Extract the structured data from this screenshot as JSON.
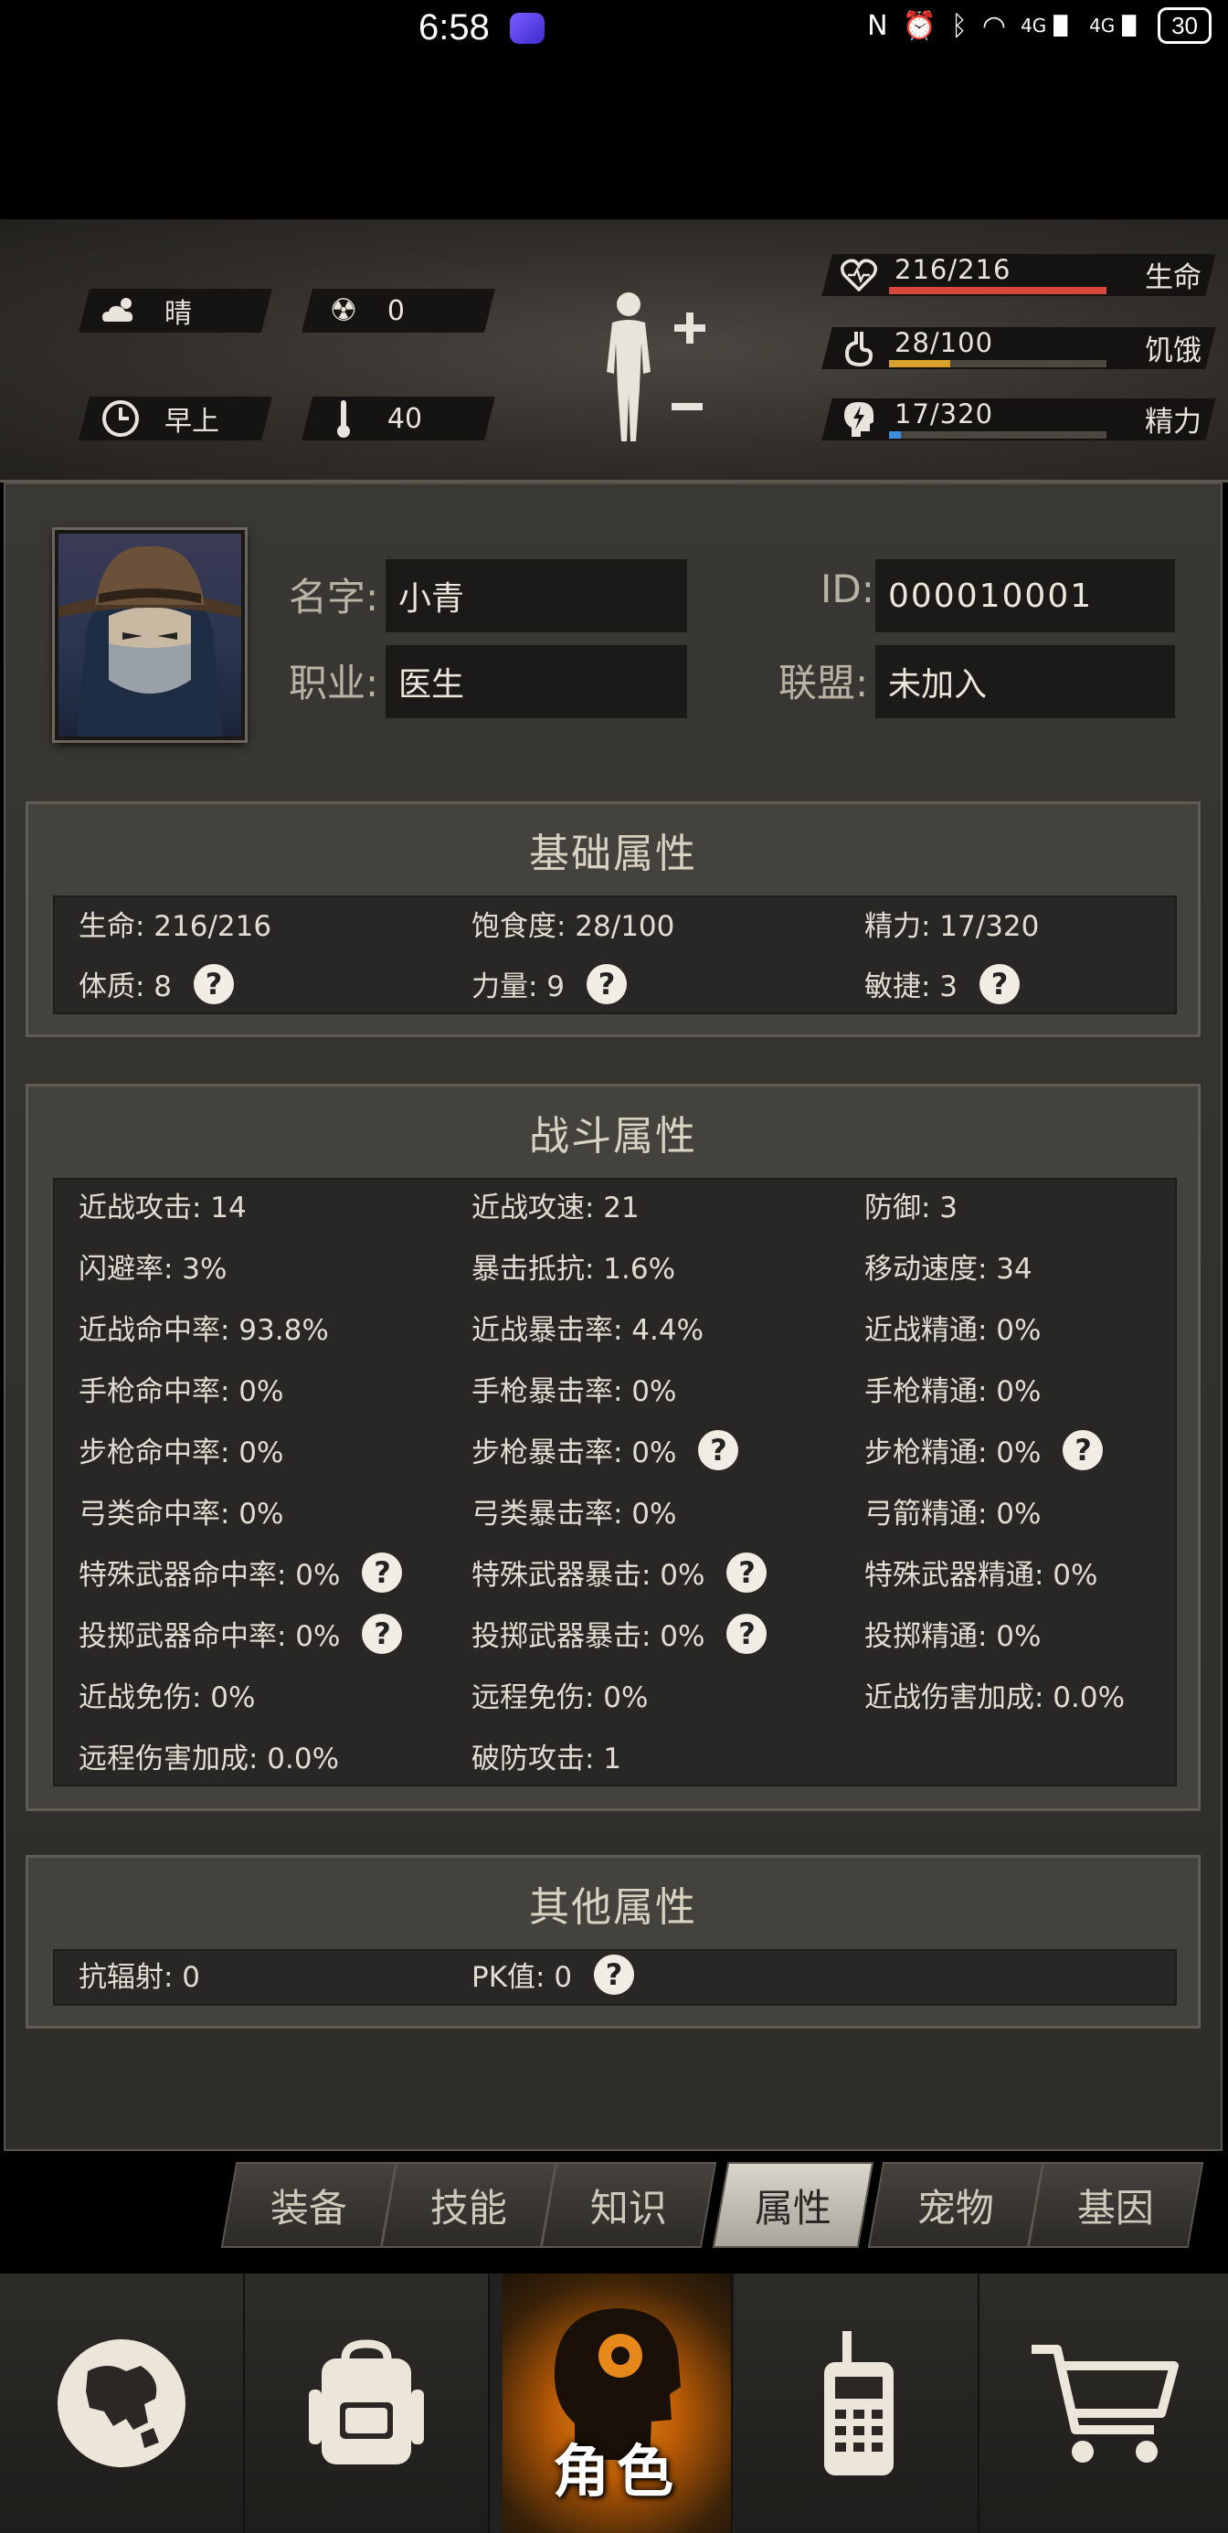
{
  "status_bar": {
    "time": "6:58",
    "battery": "30",
    "signal_1": "4G",
    "signal_2": "4G"
  },
  "hud": {
    "weather": "晴",
    "radiation": "0",
    "time_of_day": "早上",
    "temperature": "40",
    "stats": [
      {
        "value": "216/216",
        "label": "生命",
        "fill": 1.0,
        "color": "#d9473c",
        "icon": "heart-icon"
      },
      {
        "value": "28/100",
        "label": "饥饿",
        "fill": 0.28,
        "color": "#d8a12b",
        "icon": "stomach-icon"
      },
      {
        "value": "17/320",
        "label": "精力",
        "fill": 0.053,
        "color": "#3d8fe0",
        "icon": "energy-head-icon"
      }
    ]
  },
  "profile": {
    "name_label": "名字:",
    "name": "小青",
    "job_label": "职业:",
    "job": "医生",
    "id_label": "ID:",
    "id": "000010001",
    "alliance_label": "联盟:",
    "alliance": "未加入"
  },
  "basic": {
    "title": "基础属性",
    "rows": [
      [
        "生命: 216/216",
        "饱食度: 28/100",
        "精力: 17/320"
      ],
      [
        "体质: 8",
        "力量: 9",
        "敏捷: 3"
      ]
    ]
  },
  "combat": {
    "title": "战斗属性",
    "rows": [
      [
        "近战攻击: 14",
        "近战攻速: 21",
        "防御: 3"
      ],
      [
        "闪避率: 3%",
        "暴击抵抗: 1.6%",
        "移动速度: 34"
      ],
      [
        "近战命中率: 93.8%",
        "近战暴击率: 4.4%",
        "近战精通: 0%"
      ],
      [
        "手枪命中率: 0%",
        "手枪暴击率: 0%",
        "手枪精通: 0%"
      ],
      [
        "步枪命中率: 0%",
        "步枪暴击率: 0%",
        "步枪精通: 0%"
      ],
      [
        "弓类命中率: 0%",
        "弓类暴击率: 0%",
        "弓箭精通: 0%"
      ],
      [
        "特殊武器命中率: 0%",
        "特殊武器暴击: 0%",
        "特殊武器精通: 0%"
      ],
      [
        "投掷武器命中率: 0%",
        "投掷武器暴击: 0%",
        "投掷精通: 0%"
      ],
      [
        "近战免伤: 0%",
        "远程免伤: 0%",
        "近战伤害加成: 0.0%"
      ],
      [
        "远程伤害加成: 0.0%",
        "破防攻击: 1",
        ""
      ]
    ]
  },
  "other": {
    "title": "其他属性",
    "rows": [
      [
        "抗辐射: 0",
        "PK值: 0",
        ""
      ]
    ]
  },
  "tabs": [
    "装备",
    "技能",
    "知识",
    "属性",
    "宠物",
    "基因"
  ],
  "active_tab": "属性",
  "bottom_nav": {
    "active_label": "角色"
  },
  "help_mark": "?"
}
